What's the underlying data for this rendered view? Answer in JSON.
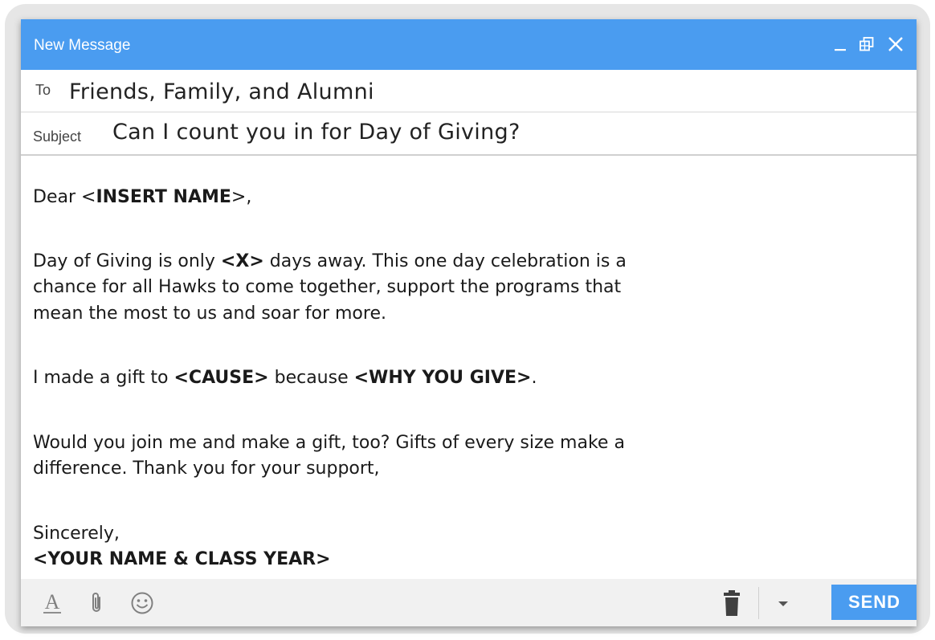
{
  "window": {
    "title": "New Message",
    "accent_color": "#4a9cf0"
  },
  "compose": {
    "to_label": "To",
    "to_value": "Friends, Family, and Alumni",
    "subject_label": "Subject",
    "subject_value": "Can I count you in for Day of Giving?"
  },
  "body": {
    "greeting_pre": "Dear <",
    "greeting_bold": "INSERT NAME",
    "greeting_post": ">,",
    "p1_pre": "Day of Giving is only ",
    "p1_bold": "<X>",
    "p1_line1_post": " days away. This one day celebration is a",
    "p1_line2": "chance for all Hawks to come together, support the programs that",
    "p1_line3": "mean the most to us and soar for more.",
    "p2_pre": "I made a gift to ",
    "p2_bold1": "<CAUSE>",
    "p2_mid": " because ",
    "p2_bold2": "<WHY YOU GIVE>",
    "p2_post": ".",
    "p3_line1": "Would you join me and make a gift, too? Gifts of every size make a",
    "p3_line2": "difference. Thank you for your support,",
    "closing": "Sincerely,",
    "signature": "<YOUR NAME & CLASS YEAR>"
  },
  "toolbar": {
    "format_icon": "text-format-icon",
    "attach_icon": "paperclip-icon",
    "emoji_icon": "smiley-icon",
    "trash_icon": "trash-icon",
    "more_icon": "caret-down-icon",
    "send_label": "SEND"
  }
}
